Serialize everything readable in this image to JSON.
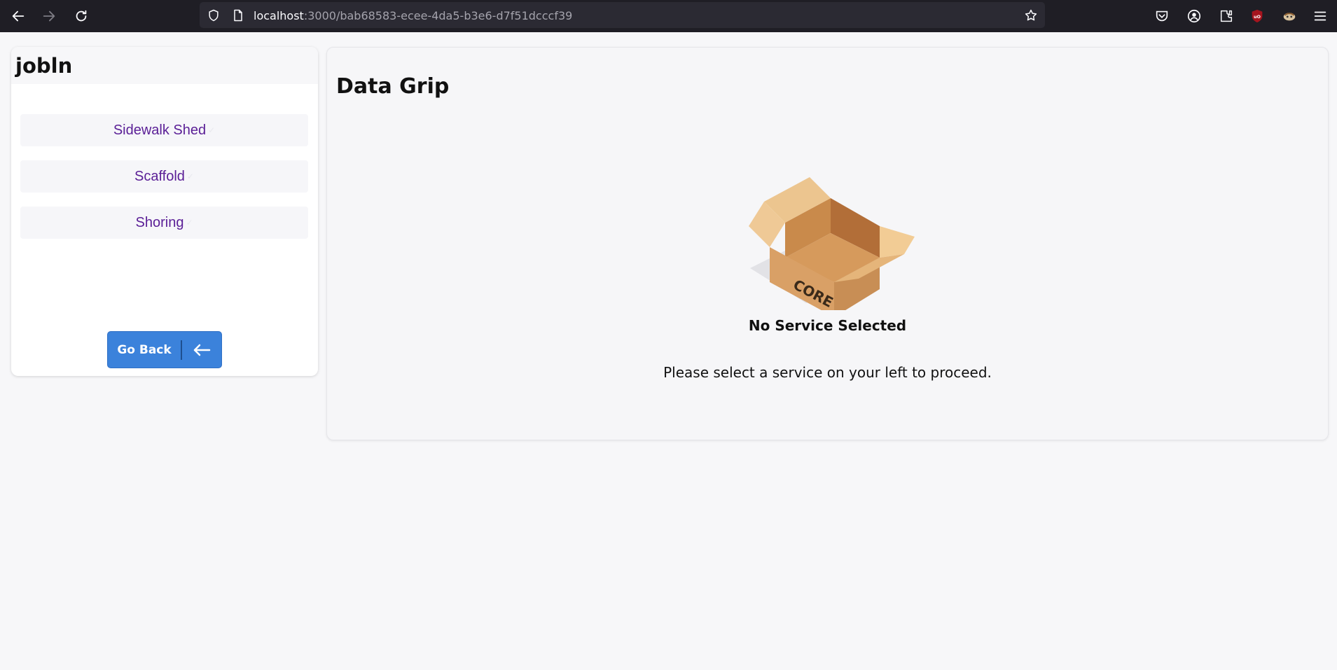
{
  "browser": {
    "url_host": "localhost",
    "url_path": ":3000/bab68583-ecee-4da5-b3e6-d7f51dcccf39"
  },
  "sidebar": {
    "title": "jobln",
    "items": [
      {
        "label": "Sidewalk Shed"
      },
      {
        "label": "Scaffold"
      },
      {
        "label": "Shoring"
      }
    ],
    "go_back_label": "Go Back"
  },
  "main": {
    "title": "Data Grip",
    "illustration_label": "CORE",
    "empty_title": "No Service Selected",
    "empty_message": "Please select a service on your left to proceed."
  },
  "colors": {
    "accent": "#3b82db",
    "item_text": "#5a1e96"
  }
}
